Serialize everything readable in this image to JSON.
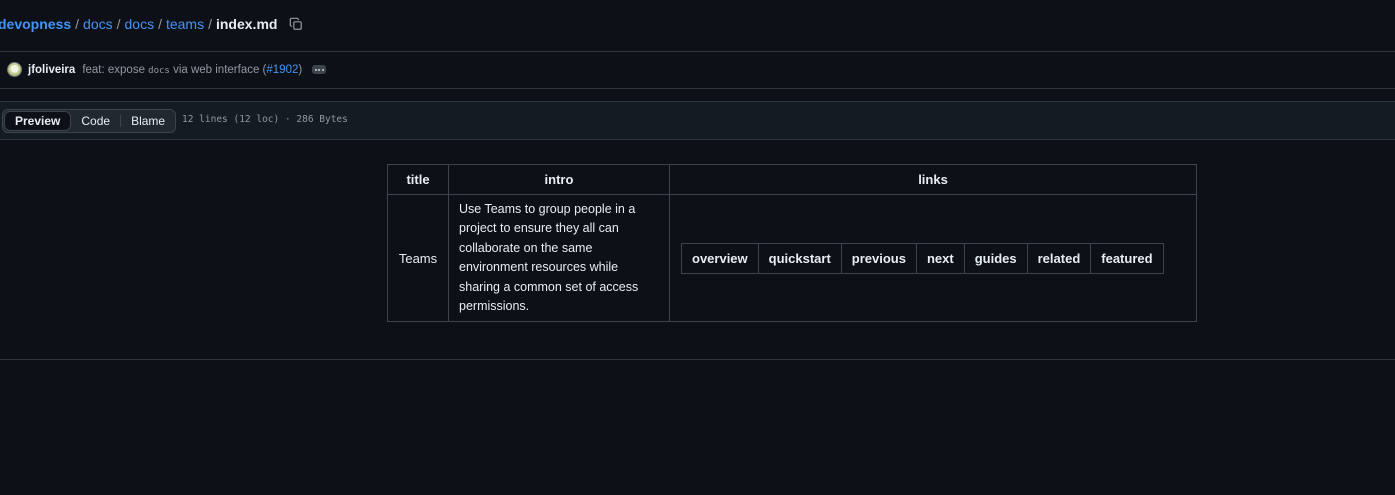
{
  "breadcrumb": {
    "items": [
      "devopness",
      "docs",
      "docs",
      "teams"
    ],
    "separator": "/",
    "current": "index.md"
  },
  "commit": {
    "author": "jfoliveira",
    "message_prefix": "feat: expose",
    "message_code": "docs",
    "message_suffix": "via web interface (",
    "pr": "#1902",
    "message_end": ")"
  },
  "toolbar": {
    "tabs": [
      "Preview",
      "Code",
      "Blame"
    ],
    "active_tab": "Preview",
    "file_info": "12 lines (12 loc) · 286 Bytes"
  },
  "table": {
    "headers": [
      "title",
      "intro",
      "links"
    ],
    "row": {
      "title": "Teams",
      "intro": "Use Teams to group people in a project to ensure they all can collaborate on the same environment resources while sharing a common set of access permissions.",
      "links": [
        "overview",
        "quickstart",
        "previous",
        "next",
        "guides",
        "related",
        "featured"
      ]
    }
  },
  "colors": {
    "background": "#0d1117",
    "link": "#4493f8",
    "border": "#30363d",
    "text": "#e6edf3",
    "muted": "#9198a1"
  }
}
